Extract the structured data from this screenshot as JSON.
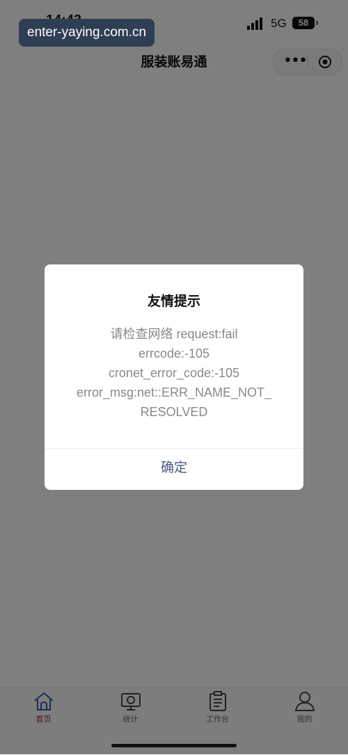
{
  "status_bar": {
    "time": "14:43",
    "network": "5G",
    "battery": "58"
  },
  "url_chip": "enter-yaying.com.cn",
  "nav": {
    "title": "服装账易通",
    "more": "•••"
  },
  "tabs": [
    {
      "label": "首页",
      "icon": "home-icon",
      "active": true
    },
    {
      "label": "统计",
      "icon": "chart-icon",
      "active": false
    },
    {
      "label": "工作台",
      "icon": "clipboard-icon",
      "active": false
    },
    {
      "label": "我的",
      "icon": "user-icon",
      "active": false
    }
  ],
  "dialog": {
    "title": "友情提示",
    "lines": [
      "请检查网络 request:fail",
      "errcode:-105",
      "cronet_error_code:-105",
      "error_msg:net::ERR_NAME_NOT_",
      "RESOLVED"
    ],
    "confirm": "确定"
  },
  "colors": {
    "accent": "#a11d1d",
    "confirm": "#4a5680",
    "mask": "rgba(0,0,0,0.5)"
  }
}
